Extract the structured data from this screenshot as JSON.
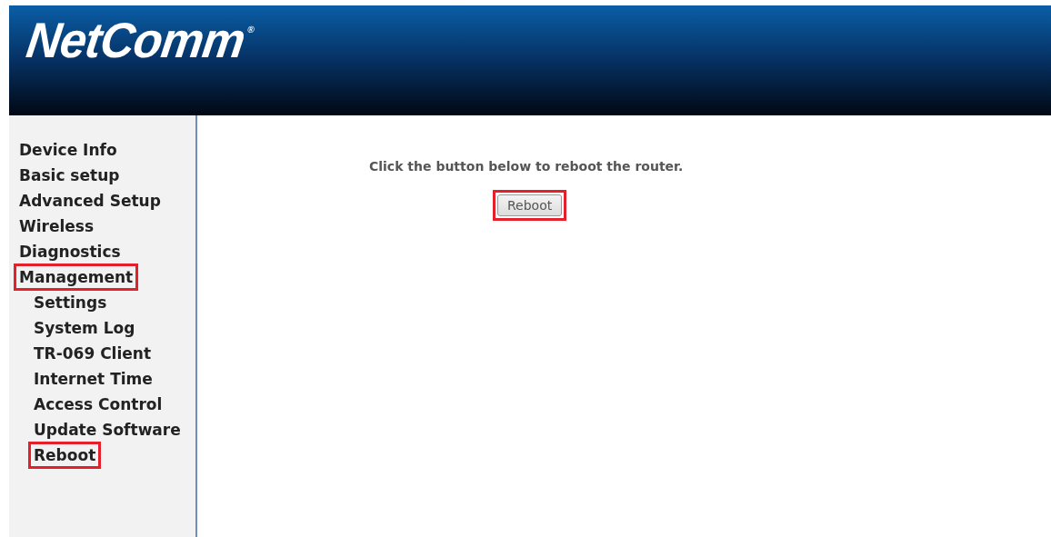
{
  "header": {
    "logo": "NetComm",
    "logo_mark": "®"
  },
  "sidebar": {
    "items": [
      {
        "label": "Device Info",
        "highlighted": false
      },
      {
        "label": "Basic setup",
        "highlighted": false
      },
      {
        "label": "Advanced Setup",
        "highlighted": false
      },
      {
        "label": "Wireless",
        "highlighted": false
      },
      {
        "label": "Diagnostics",
        "highlighted": false
      },
      {
        "label": "Management",
        "highlighted": true,
        "children": [
          {
            "label": "Settings",
            "highlighted": false
          },
          {
            "label": "System Log",
            "highlighted": false
          },
          {
            "label": "TR-069 Client",
            "highlighted": false
          },
          {
            "label": "Internet Time",
            "highlighted": false
          },
          {
            "label": "Access Control",
            "highlighted": false
          },
          {
            "label": "Update Software",
            "highlighted": false
          },
          {
            "label": "Reboot",
            "highlighted": true
          }
        ]
      }
    ]
  },
  "main": {
    "instruction": "Click the button below to reboot the router.",
    "button": {
      "label": "Reboot",
      "highlighted": true
    }
  }
}
